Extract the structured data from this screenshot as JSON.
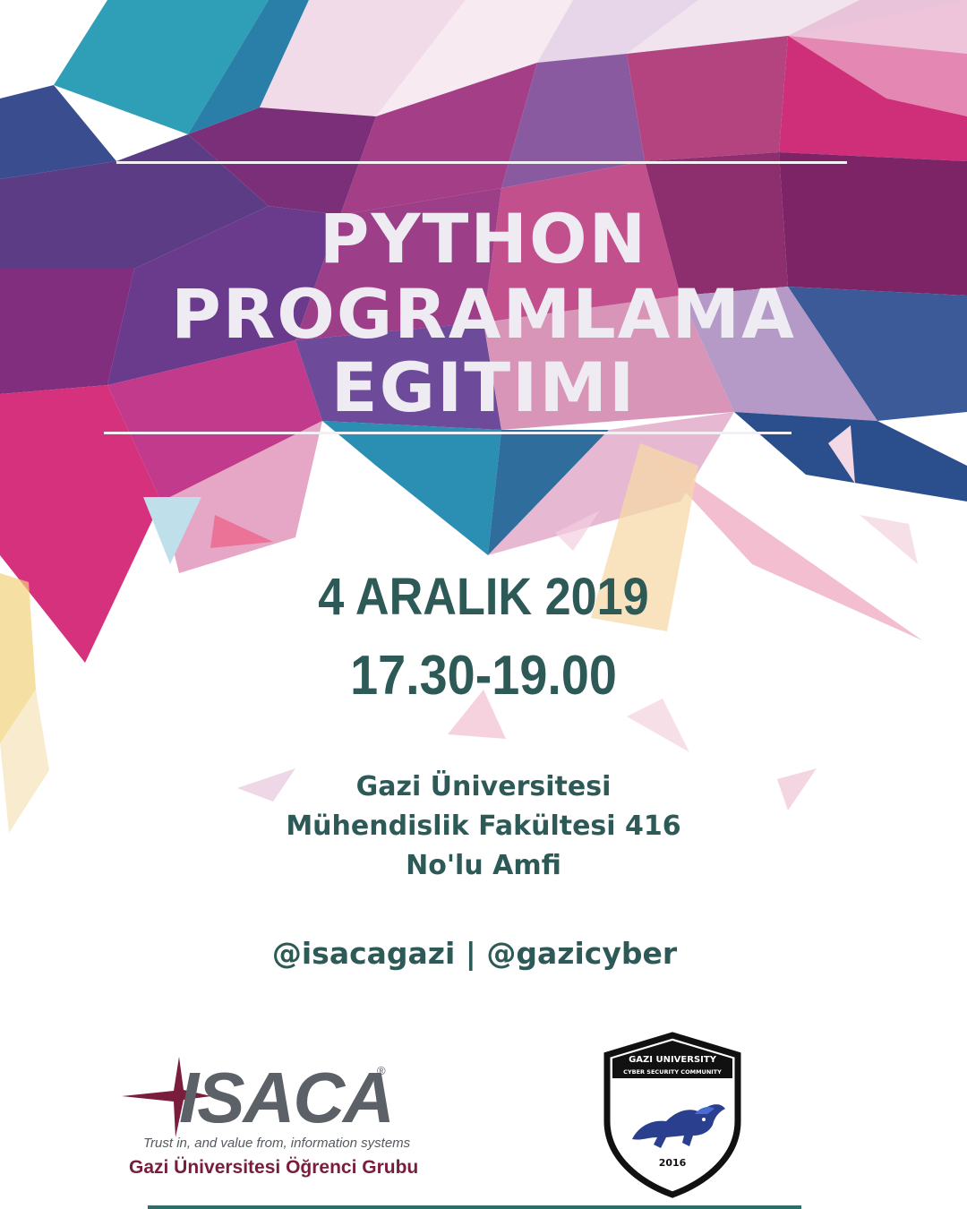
{
  "poster": {
    "title_lines": [
      "PYTHON",
      "PROGRAMLAMA",
      "EGITIMI"
    ],
    "date": "4 ARALIK 2019",
    "time": "17.30-19.00",
    "venue_lines": [
      "Gazi Üniversitesi",
      "Mühendislik Fakültesi 416",
      "No'lu Amfi"
    ],
    "social": "@isacagazi | @gazicyber"
  },
  "isaca_logo": {
    "wordmark": "ISACA",
    "registered": "®",
    "tagline": "Trust in, and value from, information systems",
    "group": "Gazi Üniversitesi Öğrenci Grubu"
  },
  "cyber_logo": {
    "top_text": "GAZI UNIVERSITY",
    "sub_text": "CYBER SECURITY COMMUNITY",
    "year": "2016"
  },
  "colors": {
    "title": "#eeecf2",
    "text_teal": "#2d5a57",
    "isaca_maroon": "#7a1c3c",
    "isaca_grey": "#5c6168"
  }
}
